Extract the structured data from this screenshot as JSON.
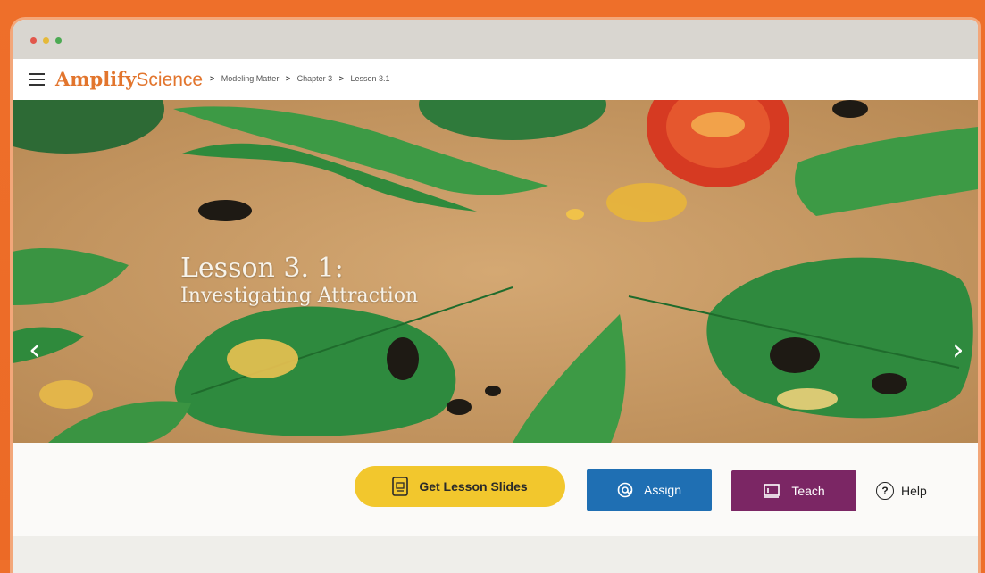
{
  "app": {
    "logo_primary": "Amplify",
    "logo_secondary": "Science"
  },
  "breadcrumb": {
    "items": [
      "Modeling Matter",
      "Chapter 3",
      "Lesson 3.1"
    ]
  },
  "hero": {
    "title_line1": "Lesson 3. 1:",
    "title_line2": "Investigating Attraction",
    "prev_glyph": "‹",
    "next_glyph": "›"
  },
  "actions": {
    "slides_label": "Get Lesson Slides",
    "assign_label": "Assign",
    "teach_label": "Teach",
    "help_label": "Help",
    "help_glyph": "?"
  },
  "colors": {
    "brand_orange": "#e2752d",
    "slides_yellow": "#f2c72d",
    "assign_blue": "#1f6fb3",
    "teach_purple": "#7b2664",
    "hero_tan": "#c79b66"
  }
}
